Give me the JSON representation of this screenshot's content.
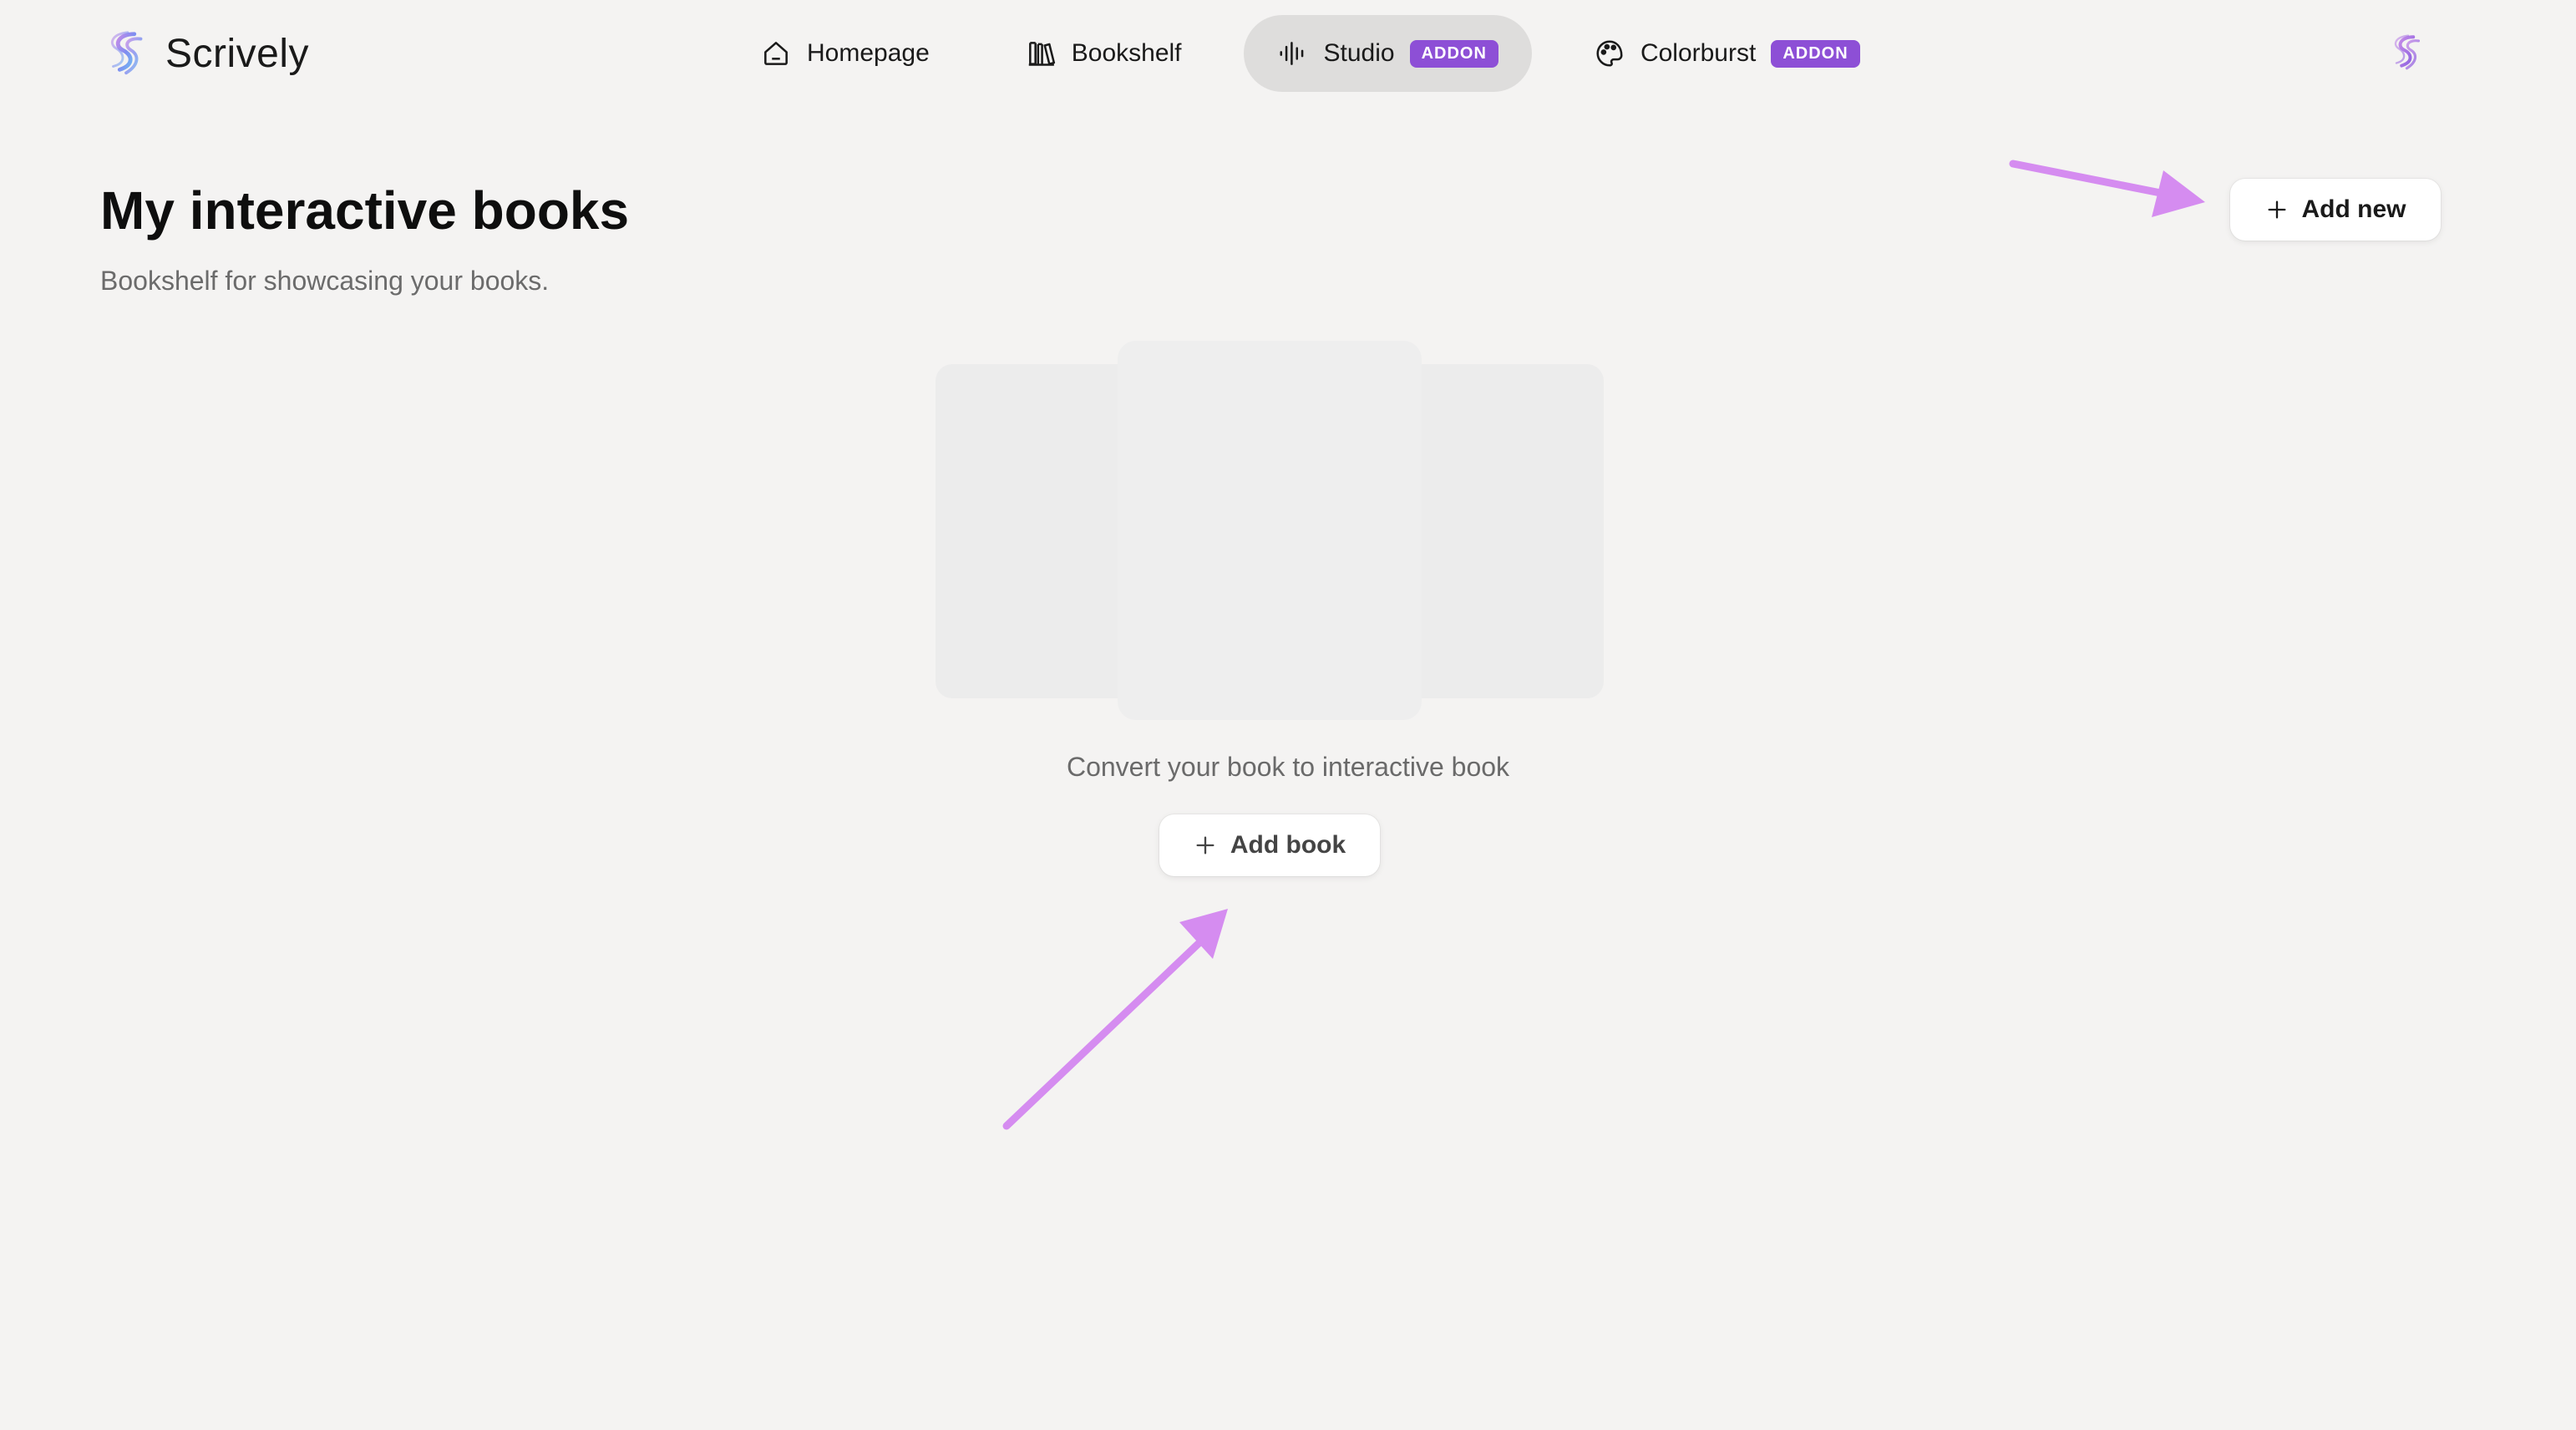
{
  "app": {
    "name": "Scrively"
  },
  "nav": {
    "items": [
      {
        "label": "Homepage",
        "icon": "home-icon",
        "badge": ""
      },
      {
        "label": "Bookshelf",
        "icon": "bookshelf-icon",
        "badge": ""
      },
      {
        "label": "Studio",
        "icon": "audio-waveform-icon",
        "badge": "ADDON",
        "active": true
      },
      {
        "label": "Colorburst",
        "icon": "palette-icon",
        "badge": "ADDON"
      }
    ]
  },
  "header": {
    "title": "My interactive books",
    "subtitle": "Bookshelf for showcasing your books.",
    "add_new_label": "Add new"
  },
  "empty_state": {
    "message": "Convert your book to interactive book",
    "add_book_label": "Add book"
  },
  "colors": {
    "background": "#f4f3f2",
    "addon_badge": "#8d4fd6",
    "annotation_arrow": "#d58cf0",
    "active_nav": "#dedddc"
  }
}
